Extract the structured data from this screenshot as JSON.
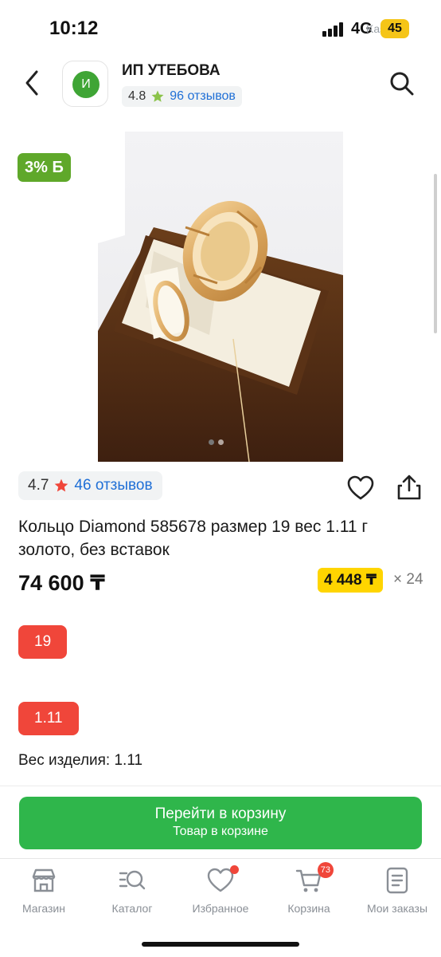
{
  "status_bar": {
    "time": "10:12",
    "network": "4G",
    "battery": "45",
    "watermark": "Kaspi.kz"
  },
  "header": {
    "shop_logo_letter": "И",
    "shop_name": "ИП УТЕБОВА",
    "shop_rating": "4.8",
    "shop_reviews": "96 отзывов",
    "icons": [
      "back-icon",
      "search-icon",
      "star-icon"
    ]
  },
  "product": {
    "discount_badge": "3% Б",
    "rating": "4.7",
    "reviews": "46 отзывов",
    "title": "Кольцо Diamond 585678 размер 19 вес 1.11 г золото, без вставок",
    "price": "74 600 ₸",
    "installment_amount": "4 448 ₸",
    "installment_months": "× 24",
    "size_chip": "19",
    "weight_chip": "1.11",
    "weight_text": "Вес изделия: 1.11",
    "image_count": 2,
    "active_image": 1
  },
  "cart_button": {
    "label": "Перейти в корзину",
    "sublabel": "Товар в корзине"
  },
  "tabbar": {
    "items": [
      {
        "label": "Магазин",
        "icon": "store-icon"
      },
      {
        "label": "Каталог",
        "icon": "catalog-search-icon"
      },
      {
        "label": "Избранное",
        "icon": "heart-icon"
      },
      {
        "label": "Корзина",
        "icon": "cart-icon",
        "badge": "73"
      },
      {
        "label": "Мои заказы",
        "icon": "orders-icon"
      }
    ]
  },
  "colors": {
    "accent_green": "#2fb64b",
    "discount_green": "#5fa82a",
    "chip_red": "#f0463a",
    "installment_yellow": "#ffd500",
    "link_blue": "#1f6fd6"
  }
}
